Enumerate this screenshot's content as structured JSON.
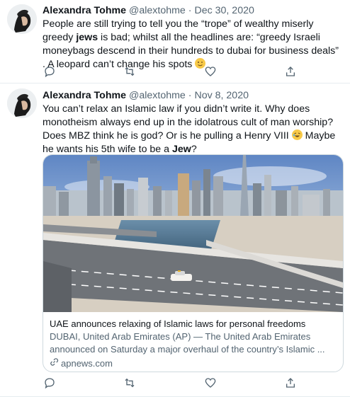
{
  "tweets": [
    {
      "author_name": "Alexandra Tohme",
      "handle": "@alextohme",
      "separator": "·",
      "date": "Dec 30, 2020",
      "text_parts": [
        "People are still trying to tell you the “trope” of wealthy miserly greedy ",
        "jews",
        " is bad; whilst all the headlines are: “greedy Israeli moneybags descend in their hundreds to dubai for business deals” . A leopard can’t change his spots "
      ],
      "emoji": "wink-emoji",
      "actions": [
        "reply-icon",
        "retweet-icon",
        "like-icon",
        "share-icon"
      ]
    },
    {
      "author_name": "Alexandra Tohme",
      "handle": "@alextohme",
      "separator": "·",
      "date": "Nov 8, 2020",
      "text_parts": [
        "You can’t relax an Islamic law if you didn’t write it. Why does monotheism always end up in the idolatrous cult of man worship? Does MBZ think he is god? Or is he pulling a Henry VIII ",
        " Maybe he wants his 5th wife to be a ",
        "Jew",
        "?"
      ],
      "emoji": "rolling-laughing-emoji",
      "card": {
        "title": "UAE announces relaxing of Islamic laws for personal freedoms",
        "description": "DUBAI, United Arab Emirates (AP) — The United Arab Emirates announced on Saturday a major overhaul of the country’s Islamic ...",
        "domain": "apnews.com"
      },
      "actions": [
        "reply-icon",
        "retweet-icon",
        "like-icon",
        "share-icon"
      ]
    }
  ],
  "colors": {
    "text": "#0f1419",
    "secondary": "#536471",
    "border": "#e6ecf0"
  }
}
